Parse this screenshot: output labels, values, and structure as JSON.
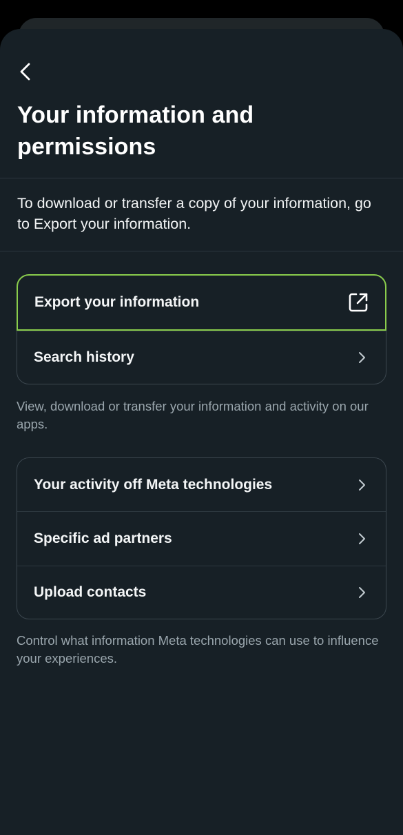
{
  "header": {
    "title": "Your information and permissions"
  },
  "intro": {
    "text": "To download or transfer a copy of your information, go to Export your information."
  },
  "section1": {
    "items": [
      {
        "label": "Export your information",
        "icon": "external-link-icon"
      },
      {
        "label": "Search history",
        "icon": "chevron-right-icon"
      }
    ],
    "helper": "View, download or transfer your information and activity on our apps."
  },
  "section2": {
    "items": [
      {
        "label": "Your activity off Meta technologies",
        "icon": "chevron-right-icon"
      },
      {
        "label": "Specific ad partners",
        "icon": "chevron-right-icon"
      },
      {
        "label": "Upload contacts",
        "icon": "chevron-right-icon"
      }
    ],
    "helper": "Control what information Meta technologies can use to influence your experiences."
  },
  "colors": {
    "background": "#172026",
    "focus_outline": "#8acd4c",
    "primary_text": "#ffffff",
    "secondary_text": "#9aa6ad"
  }
}
